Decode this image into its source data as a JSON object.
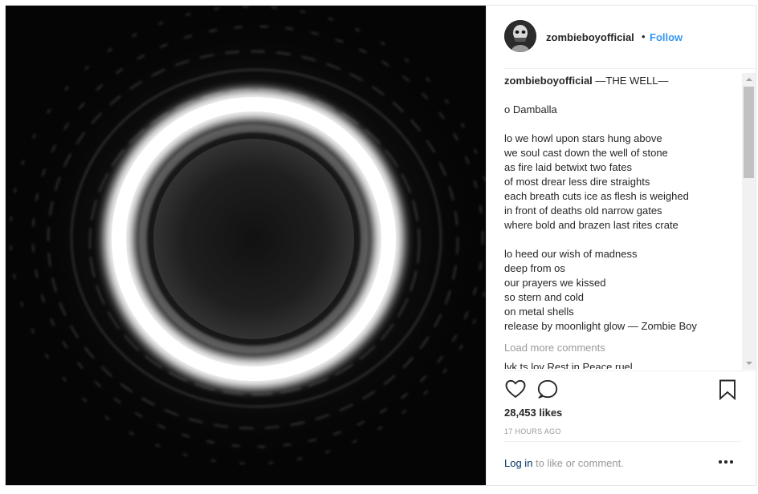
{
  "post": {
    "username": "zombieboyofficial",
    "separator": "•",
    "follow_label": "Follow",
    "caption": {
      "username": "zombieboyofficial",
      "title": " —THE WELL—",
      "lines": [
        "o Damballa",
        "",
        "lo we howl upon stars hung above",
        "we soul cast down the well of stone",
        "as fire laid betwixt two fates",
        "of most drear less dire straights",
        "each breath cuts ice as flesh is weighed",
        "in front of deaths old narrow gates",
        "where bold and brazen last rites crate",
        "",
        "lo heed our wish of madness",
        "deep from os",
        "our prayers we kissed",
        "so stern and cold",
        "on metal shells",
        "release by moonlight glow — Zombie Boy"
      ]
    },
    "load_more_label": "Load more comments",
    "partial_comment": "lvk  ts  lov  Rest in Peace     ruel",
    "likes": "28,453 likes",
    "time": "17 HOURS AGO",
    "login_label": "Log in",
    "login_suffix": " to like or comment."
  },
  "icons": {
    "avatar": "avatar",
    "like": "heart-icon",
    "comment": "comment-icon",
    "save": "bookmark-icon",
    "more": "more-options-icon"
  },
  "colors": {
    "link": "#3897f0",
    "muted": "#999999",
    "text": "#262626"
  }
}
